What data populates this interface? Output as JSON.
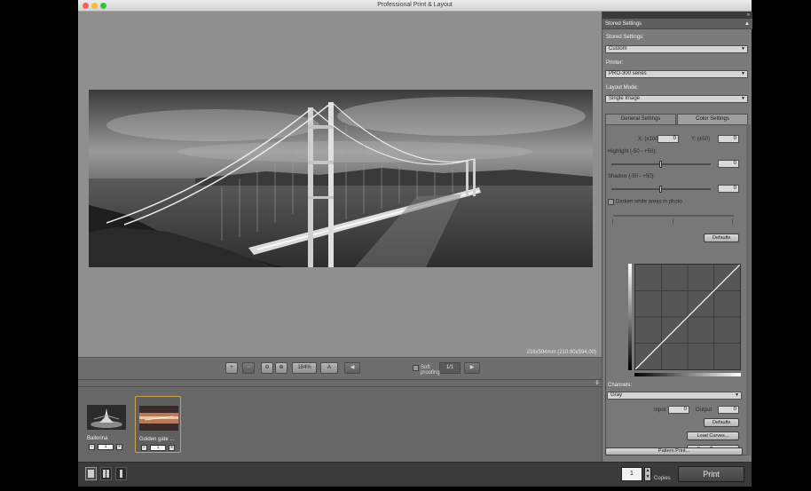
{
  "window": {
    "title": "Professional Print & Layout"
  },
  "preview": {
    "dimensions_text": "216x594mm (210.90x594.00)"
  },
  "view_toolbar": {
    "zoom_value": "184%",
    "view_mode": "A",
    "page_indicator": "1/1",
    "soft_proofing_label": "Soft proofing"
  },
  "thumbnails": [
    {
      "name": "Ballerina",
      "copies": "1"
    },
    {
      "name": "Golden gate ...",
      "copies": "1"
    }
  ],
  "sidebar": {
    "section_title": "Stored Settings",
    "stored_settings_label": "Stored Settings:",
    "stored_settings_value": "Custom",
    "printer_label": "Printer:",
    "printer_value": "PRO-300 series",
    "layout_mode_label": "Layout Mode:",
    "layout_mode_value": "Single Image",
    "tabs": [
      "General Settings",
      "Color Settings"
    ],
    "color": {
      "x_label": "X: (±100)",
      "x_value": "0",
      "y_label": "Y: (±50)",
      "y_value": "0",
      "highlight_label": "Highlight (-50 - +50):",
      "highlight_value": "0",
      "shadow_label": "Shadow (-50 - +50):",
      "shadow_value": "0",
      "darken_label": "Darken white areas in photo",
      "defaults_label": "Defaults",
      "channels_label": "Channels:",
      "channels_value": "Gray",
      "input_label": "Input",
      "input_value": "0",
      "output_label": "Output",
      "output_value": "0",
      "defaults2_label": "Defaults",
      "load_curves_label": "Load Curves...",
      "save_curves_label": "Save Curves...",
      "pattern_print_label": "Pattern Print..."
    }
  },
  "bottom": {
    "copies_value": "1",
    "copies_label": "Copies",
    "print_label": "Print"
  }
}
